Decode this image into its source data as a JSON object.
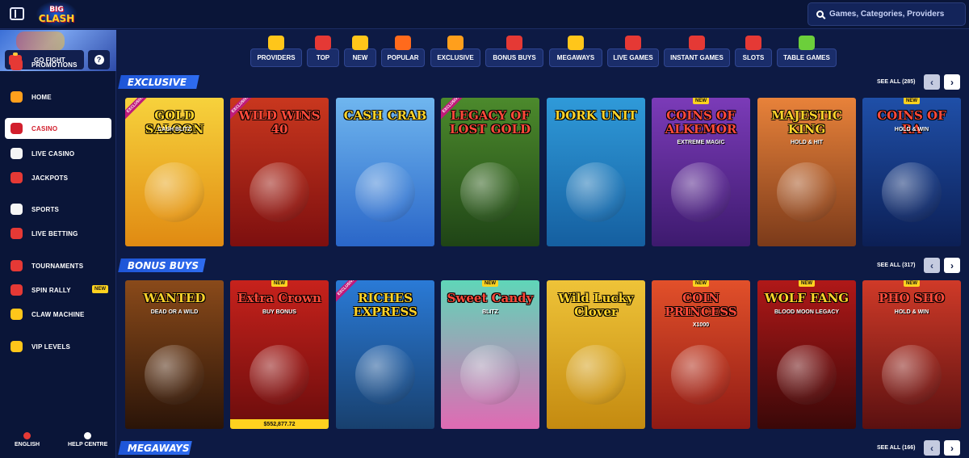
{
  "header": {
    "logo_line1": "BIG",
    "logo_line2": "CLASH",
    "search_placeholder": "Games, Categories, Providers"
  },
  "sidebar": {
    "promo": {
      "go_fight_label": "GO FIGHT",
      "help_symbol": "?"
    },
    "items": [
      {
        "label": "PROMOTIONS",
        "icon": "megaphone-icon",
        "color": "#e53935"
      },
      {
        "label": "HOME",
        "icon": "home-icon",
        "color": "#ff9f1c"
      },
      {
        "label": "CASINO",
        "icon": "roulette-icon",
        "color": "#d21f2d",
        "active": true
      },
      {
        "label": "LIVE CASINO",
        "icon": "dice-icon",
        "color": "#f5f5f5"
      },
      {
        "label": "JACKPOTS",
        "icon": "seven-icon",
        "color": "#e53935"
      },
      {
        "label": "SPORTS",
        "icon": "soccer-ball-icon",
        "color": "#f5f5f5"
      },
      {
        "label": "LIVE BETTING",
        "icon": "play-icon",
        "color": "#e53935"
      },
      {
        "label": "TOURNAMENTS",
        "icon": "trophy-icon",
        "color": "#e53935"
      },
      {
        "label": "SPIN RALLY",
        "icon": "flag-icon",
        "color": "#e53935",
        "badge": "NEW"
      },
      {
        "label": "CLAW MACHINE",
        "icon": "claw-icon",
        "color": "#ffc61a"
      },
      {
        "label": "VIP LEVELS",
        "icon": "coin-icon",
        "color": "#ffc61a"
      }
    ],
    "footer": {
      "language": "ENGLISH",
      "help": "HELP CENTRE"
    }
  },
  "categories": [
    {
      "label": "PROVIDERS",
      "icon": "bar-icon",
      "color": "#ffc61a"
    },
    {
      "label": "TOP",
      "icon": "crown-icon",
      "color": "#e53935"
    },
    {
      "label": "NEW",
      "icon": "lightning-icon",
      "color": "#ffc61a"
    },
    {
      "label": "POPULAR",
      "icon": "fire-icon",
      "color": "#ff6a1c"
    },
    {
      "label": "EXCLUSIVE",
      "icon": "diamond-icon",
      "color": "#ff9f1c"
    },
    {
      "label": "BONUS BUYS",
      "icon": "gift-icon",
      "color": "#e53935"
    },
    {
      "label": "MEGAWAYS",
      "icon": "m-icon",
      "color": "#ffc61a"
    },
    {
      "label": "LIVE GAMES",
      "icon": "chip-icon",
      "color": "#e53935"
    },
    {
      "label": "INSTANT GAMES",
      "icon": "joystick-icon",
      "color": "#e53935"
    },
    {
      "label": "SLOTS",
      "icon": "cherry-icon",
      "color": "#e53935"
    },
    {
      "label": "TABLE GAMES",
      "icon": "cards-icon",
      "color": "#6ccf3b"
    }
  ],
  "sections": [
    {
      "title": "EXCLUSIVE",
      "see_all": "SEE ALL (285)",
      "games": [
        {
          "title": "GOLD SALOON",
          "sub": "CASH BLITZ",
          "colors": [
            "#f7d23c",
            "#e08a12"
          ],
          "exclusive": true
        },
        {
          "title": "WILD WINS 40",
          "sub": "",
          "colors": [
            "#c9371e",
            "#7d0f0f"
          ],
          "exclusive": true
        },
        {
          "title": "CASH CRAB",
          "sub": "",
          "colors": [
            "#6fb6ef",
            "#2a66c8"
          ]
        },
        {
          "title": "LEGACY OF LOST GOLD",
          "sub": "",
          "colors": [
            "#4c8a2c",
            "#1f4416"
          ],
          "exclusive": true
        },
        {
          "title": "DORK UNIT",
          "sub": "",
          "colors": [
            "#2f9ad9",
            "#155fa0"
          ]
        },
        {
          "title": "COINS OF ALKEMOR",
          "sub": "EXTREME MAGIC",
          "colors": [
            "#7b3bb8",
            "#3d1a6e"
          ],
          "new": "NEW"
        },
        {
          "title": "MAJESTIC KING",
          "sub": "HOLD & HIT",
          "colors": [
            "#e8823a",
            "#7b3a1a"
          ]
        },
        {
          "title": "COINS OF RA",
          "sub": "HOLD & WIN",
          "colors": [
            "#1f4fa8",
            "#0c1f55"
          ],
          "new": "NEW"
        }
      ]
    },
    {
      "title": "BONUS BUYS",
      "see_all": "SEE ALL (317)",
      "games": [
        {
          "title": "WANTED",
          "sub": "DEAD OR A WILD",
          "colors": [
            "#8a4a1a",
            "#2a1408"
          ]
        },
        {
          "title": "Extra Crown",
          "sub": "BUY BONUS",
          "colors": [
            "#c7221c",
            "#6a0c0c"
          ],
          "new": "NEW",
          "jackpot": "$552,877.72"
        },
        {
          "title": "RICHES EXPRESS",
          "sub": "",
          "colors": [
            "#2a7ad6",
            "#18406e"
          ],
          "exclusive": true
        },
        {
          "title": "Sweet Candy",
          "sub": "BLITZ",
          "colors": [
            "#5fd6b8",
            "#e06ab3"
          ],
          "new": "NEW"
        },
        {
          "title": "Wild Lucky Clover",
          "sub": "",
          "colors": [
            "#eec338",
            "#c48a10"
          ]
        },
        {
          "title": "COIN PRINCESS",
          "sub": "X1000",
          "colors": [
            "#e2502a",
            "#8f1a14"
          ],
          "new": "NEW"
        },
        {
          "title": "WOLF FANG",
          "sub": "BLOOD MOON LEGACY",
          "colors": [
            "#b01818",
            "#3a0808"
          ],
          "new": "NEW"
        },
        {
          "title": "PHO SHO",
          "sub": "HOLD & WIN",
          "colors": [
            "#d03a28",
            "#5a1010"
          ],
          "new": "NEW"
        }
      ]
    },
    {
      "title": "MEGAWAYS",
      "see_all": "SEE ALL (166)",
      "games": []
    }
  ],
  "badges": {
    "exclusive": "EXCLUSIVE"
  },
  "arrows": {
    "prev": "‹",
    "next": "›"
  }
}
